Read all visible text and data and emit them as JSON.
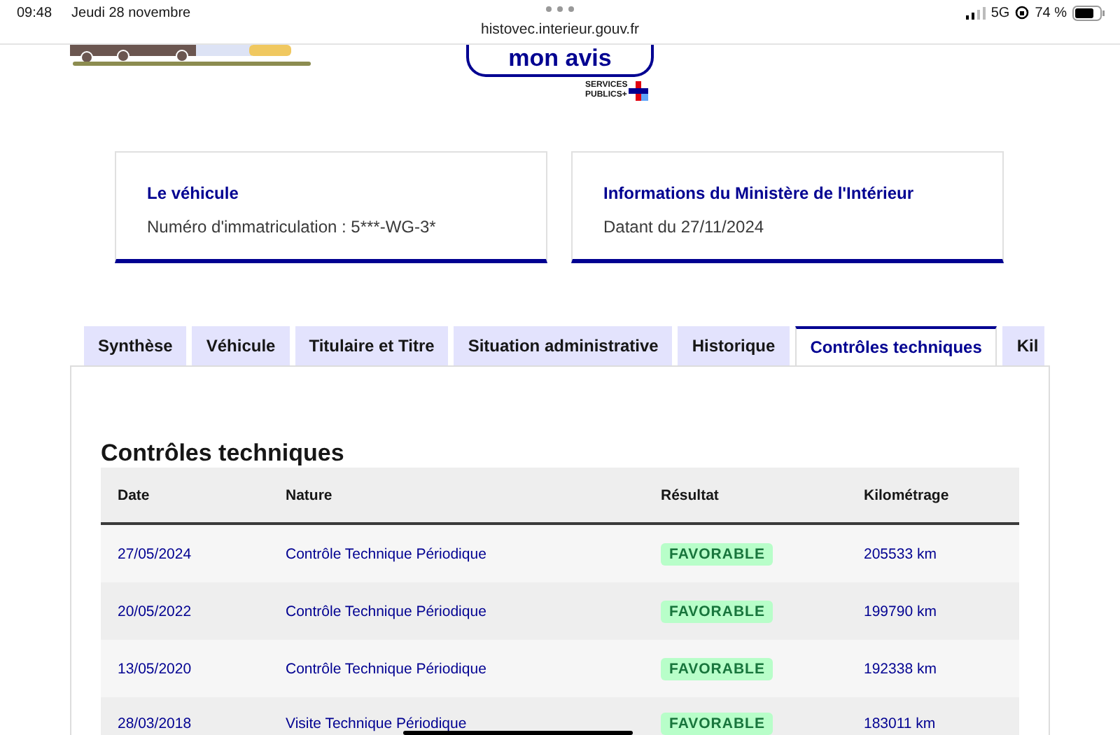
{
  "status_bar": {
    "time": "09:48",
    "date": "Jeudi 28 novembre",
    "network": "5G",
    "battery": "74 %",
    "url": "histovec.interieur.gouv.fr"
  },
  "header": {
    "feedback_button": "mon avis",
    "logo_lines": [
      "SERVICES",
      "PUBLICS+"
    ]
  },
  "cards": [
    {
      "title": "Le véhicule",
      "text": "Numéro d'immatriculation : 5***-WG-3*"
    },
    {
      "title": "Informations du Ministère de l'Intérieur",
      "text": "Datant du 27/11/2024"
    }
  ],
  "tabs": [
    {
      "label": "Synthèse",
      "selected": false
    },
    {
      "label": "Véhicule",
      "selected": false
    },
    {
      "label": "Titulaire et Titre",
      "selected": false
    },
    {
      "label": "Situation administrative",
      "selected": false
    },
    {
      "label": "Historique",
      "selected": false
    },
    {
      "label": "Contrôles techniques",
      "selected": true
    },
    {
      "label": "Kil",
      "selected": false
    }
  ],
  "section_title": "Contrôles techniques",
  "table": {
    "columns": [
      "Date",
      "Nature",
      "Résultat",
      "Kilométrage"
    ],
    "rows": [
      {
        "date": "27/05/2024",
        "nature": "Contrôle Technique Périodique",
        "result": "FAVORABLE",
        "mileage": "205533 km"
      },
      {
        "date": "20/05/2022",
        "nature": "Contrôle Technique Périodique",
        "result": "FAVORABLE",
        "mileage": "199790 km"
      },
      {
        "date": "13/05/2020",
        "nature": "Contrôle Technique Périodique",
        "result": "FAVORABLE",
        "mileage": "192338 km"
      },
      {
        "date": "28/03/2018",
        "nature": "Visite Technique Périodique",
        "result": "FAVORABLE",
        "mileage": "183011 km"
      }
    ]
  }
}
